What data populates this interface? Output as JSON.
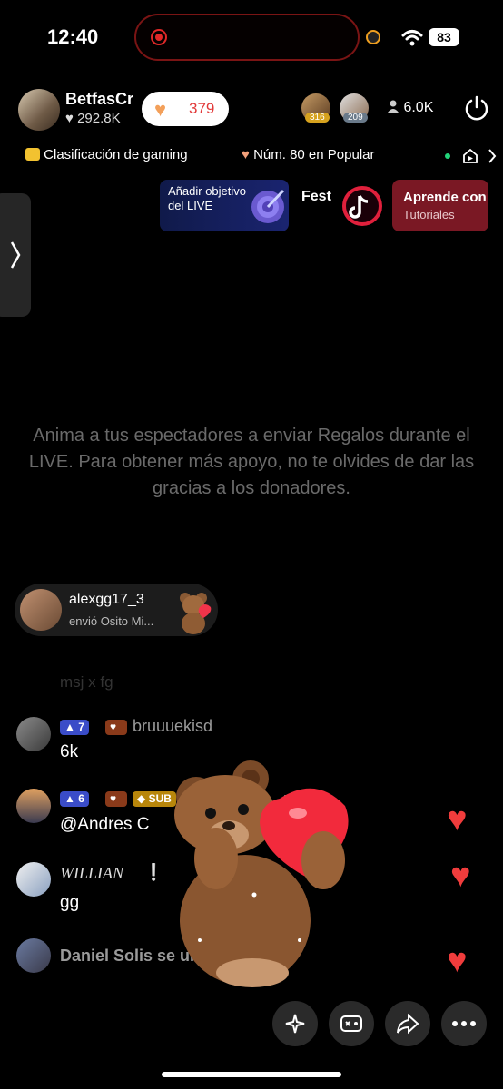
{
  "status": {
    "time": "12:40",
    "battery": "83"
  },
  "host": {
    "name": "BetfasCr",
    "likes": "292.8K",
    "like_pill": "379"
  },
  "viewers": {
    "badge1": "316",
    "badge2": "209",
    "count": "6.0K"
  },
  "ranking": {
    "gaming": "Clasificación de gaming",
    "popular": "Núm. 80 en Popular"
  },
  "banners": {
    "goal": "Añadir objetivo del LIVE",
    "fest": "Fest",
    "learn_title": "Aprende con",
    "learn_sub": "Tutoriales"
  },
  "center_message": "Anima a tus espectadores a enviar Regalos durante el LIVE. Para obtener más apoyo, no te olvides de dar las gracias a los donadores.",
  "gift": {
    "user": "alexgg17_3",
    "action": "envió Osito Mi..."
  },
  "chat": {
    "faded": "msj x fg",
    "m1": {
      "level": "7",
      "name": "bruuuekisd",
      "text": "6k"
    },
    "m2": {
      "level": "6",
      "sub": "SUB",
      "name": "@Andres C",
      "name_tail": "r22"
    },
    "m3": {
      "name": "WILLIAN",
      "mark": "❕",
      "text": "gg"
    },
    "m4": {
      "text": "Daniel Solis se uni"
    }
  },
  "colors": {
    "accent_red": "#f03c3c",
    "learn_bg": "#7a1824",
    "goal_bg": "#1a2470"
  },
  "icons": [
    "rec-icon",
    "wifi-icon",
    "heart-icon",
    "person-icon",
    "power-icon",
    "trophy-icon",
    "play-icon",
    "chevron-right-icon",
    "target-icon",
    "tiktok-icon",
    "chevron-left-icon",
    "heart-float-icon",
    "sparkle-icon",
    "gamepad-icon",
    "share-icon",
    "more-icon",
    "bear-gift-icon"
  ]
}
